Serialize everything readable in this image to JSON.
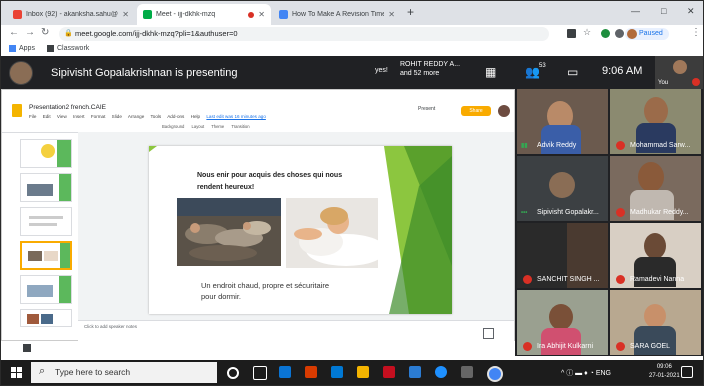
{
  "browser": {
    "tabs": [
      {
        "label": "Inbox (92) - akanksha.sahu@the",
        "favicon": "gmail-icon",
        "color": "#ea4335"
      },
      {
        "label": "Meet - ijj-dkhk-mzq",
        "favicon": "meet-icon",
        "color": "#00ac47"
      },
      {
        "label": "How To Make A Revision Timeta",
        "favicon": "page-icon",
        "color": "#4285f4"
      }
    ],
    "new_tab": "+",
    "window": {
      "minimize": "—",
      "maximize": "□",
      "close": "✕"
    },
    "url": "meet.google.com/ijj-dkhk-mzq?pli=1&authuser=0",
    "paused_label": "Paused",
    "bookmarks": [
      "Apps",
      "Classwork"
    ]
  },
  "meet": {
    "presenting_text": "Sipivisht Gopalakrishnan is presenting",
    "chat_preview_sender": "ROHIT REDDY A...",
    "chat_preview_more": "and 52 more",
    "chat_preview_word": "yes!",
    "participant_count_badge": "53",
    "time": "9:06 AM",
    "self_label": "You"
  },
  "slides_app": {
    "doc_title": "Presentation2 french.CAIE",
    "menu": [
      "File",
      "Edit",
      "View",
      "Insert",
      "Format",
      "Slide",
      "Arrange",
      "Tools",
      "Add-ons",
      "Help"
    ],
    "last_edit": "Last edit was 16 minutes ago",
    "toolbar": [
      "Background",
      "Layout",
      "Theme",
      "Transition"
    ],
    "present_label": "Present",
    "share_label": "Share",
    "speaker_notes": "Click to add speaker notes"
  },
  "slide": {
    "title": "Nous enir pour acquis des choses qui nous rendent heureux!",
    "caption": "Un endroit chaud, propre et sécuritaire pour dormir."
  },
  "participants": [
    {
      "name": "Advik Reddy",
      "muted": false,
      "speaking": true
    },
    {
      "name": "Mohammad Sarw...",
      "muted": true,
      "speaking": false
    },
    {
      "name": "Sipivisht Gopalakr...",
      "muted": false,
      "speaking": false
    },
    {
      "name": "Madhukar Reddy...",
      "muted": true,
      "speaking": false
    },
    {
      "name": "SANCHIT SINGH ...",
      "muted": true,
      "speaking": false
    },
    {
      "name": "Ramadevi Nanna",
      "muted": true,
      "speaking": false
    },
    {
      "name": "Ira Abhijit Kulkarni",
      "muted": true,
      "speaking": false
    },
    {
      "name": "SARA GOEL",
      "muted": true,
      "speaking": false
    }
  ],
  "taskbar": {
    "search_placeholder": "Type here to search",
    "language": "ENG",
    "time": "09:06",
    "date": "27-01-2021"
  }
}
